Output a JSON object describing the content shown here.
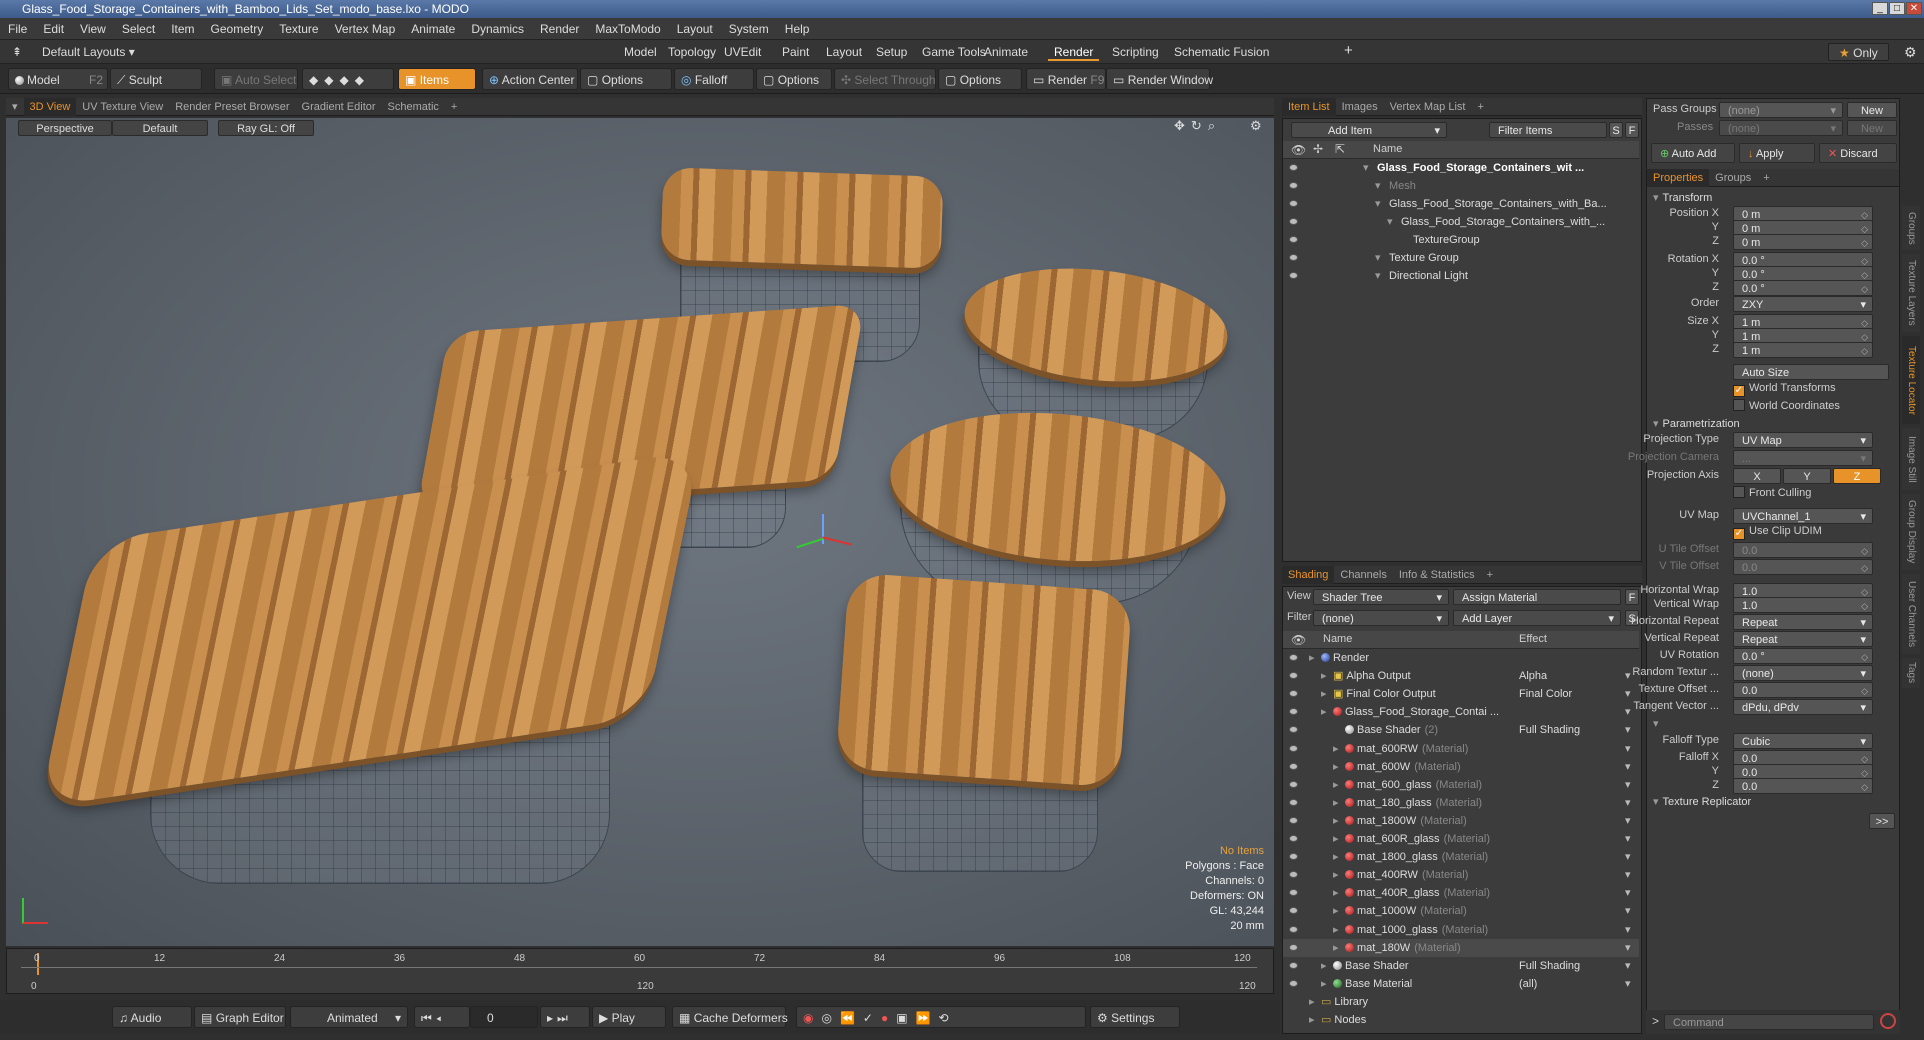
{
  "window": {
    "title": "Glass_Food_Storage_Containers_with_Bamboo_Lids_Set_modo_base.lxo - MODO",
    "controls": [
      "_",
      "□",
      "✕"
    ]
  },
  "menu": [
    "File",
    "Edit",
    "View",
    "Select",
    "Item",
    "Geometry",
    "Texture",
    "Vertex Map",
    "Animate",
    "Dynamics",
    "Render",
    "MaxToModo",
    "Layout",
    "System",
    "Help"
  ],
  "layout": {
    "preset": "Default Layouts ▾",
    "tabs": [
      "Model",
      "Topology",
      "UVEdit",
      "Paint",
      "Layout",
      "Setup",
      "Game Tools",
      "Animate",
      "Render",
      "Scripting",
      "Schematic Fusion"
    ],
    "active_tab": "Render",
    "only_label": "Only"
  },
  "toolbar": {
    "model": "Model",
    "model_key": "F2",
    "sculpt": "Sculpt",
    "auto_select": "Auto Select",
    "items": "Items",
    "action_center": "Action Center",
    "options1": "Options",
    "falloff": "Falloff",
    "options2": "Options",
    "select_through": "Select Through",
    "options3": "Options",
    "render": "Render",
    "render_key": "F9",
    "render_window": "Render Window"
  },
  "viewport": {
    "tabs": [
      "3D View",
      "UV Texture View",
      "Render Preset Browser",
      "Gradient Editor",
      "Schematic"
    ],
    "active_tab": "3D View",
    "perspective": "Perspective",
    "default": "Default",
    "raygl": "Ray GL: Off",
    "hud": {
      "status": "No Items",
      "polygons": "Polygons : Face",
      "channels": "Channels: 0",
      "deformers": "Deformers: ON",
      "gl": "GL: 43,244",
      "scale": "20 mm"
    }
  },
  "timeline": {
    "top_ticks": [
      "0",
      "12",
      "24",
      "36",
      "48",
      "60",
      "72",
      "84",
      "96",
      "108",
      "120"
    ],
    "bottom_start": "0",
    "bottom_mid": "120",
    "bottom_end": "120"
  },
  "bottom": {
    "audio": "Audio",
    "graph_editor": "Graph Editor",
    "animated": "Animated",
    "frame": "0",
    "play": "Play",
    "cache": "Cache Deformers",
    "settings": "Settings"
  },
  "item_list": {
    "tabs": [
      "Item List",
      "Images",
      "Vertex Map List"
    ],
    "active_tab": "Item List",
    "add_item": "Add Item",
    "filter": "Filter Items",
    "s": "S",
    "f": "F",
    "col_name": "Name",
    "rows": [
      {
        "label": "Glass_Food_Storage_Containers_wit ...",
        "indent": 0,
        "bold": true
      },
      {
        "label": "Mesh",
        "indent": 1,
        "dim": true
      },
      {
        "label": "Glass_Food_Storage_Containers_with_Ba...",
        "indent": 1
      },
      {
        "label": "Glass_Food_Storage_Containers_with_...",
        "indent": 2
      },
      {
        "label": "TextureGroup",
        "indent": 3
      },
      {
        "label": "Texture Group",
        "indent": 1
      },
      {
        "label": "Directional Light",
        "indent": 1
      }
    ]
  },
  "shading": {
    "tabs": [
      "Shading",
      "Channels",
      "Info & Statistics"
    ],
    "active_tab": "Shading",
    "view_label": "View",
    "view_value": "Shader Tree",
    "assign": "Assign Material",
    "filter_label": "Filter",
    "filter_value": "(none)",
    "add_layer": "Add Layer",
    "col_name": "Name",
    "col_effect": "Effect",
    "rows": [
      {
        "name": "Render",
        "suffix": "",
        "effect": "",
        "ball": "bl",
        "indent": 0
      },
      {
        "name": "Alpha Output",
        "suffix": "",
        "effect": "Alpha",
        "ball": "out",
        "indent": 1
      },
      {
        "name": "Final Color Output",
        "suffix": "",
        "effect": "Final Color",
        "ball": "out",
        "indent": 1
      },
      {
        "name": "Glass_Food_Storage_Contai ...",
        "suffix": "",
        "effect": "",
        "ball": "rd",
        "indent": 1
      },
      {
        "name": "Base Shader",
        "suffix": "(2)",
        "effect": "Full Shading",
        "ball": "wh",
        "indent": 2
      },
      {
        "name": "mat_600RW",
        "suffix": "(Material)",
        "effect": "",
        "ball": "rd",
        "indent": 2
      },
      {
        "name": "mat_600W",
        "suffix": "(Material)",
        "effect": "",
        "ball": "rd",
        "indent": 2
      },
      {
        "name": "mat_600_glass",
        "suffix": "(Material)",
        "effect": "",
        "ball": "rd",
        "indent": 2
      },
      {
        "name": "mat_180_glass",
        "suffix": "(Material)",
        "effect": "",
        "ball": "rd",
        "indent": 2
      },
      {
        "name": "mat_1800W",
        "suffix": "(Material)",
        "effect": "",
        "ball": "rd",
        "indent": 2
      },
      {
        "name": "mat_600R_glass",
        "suffix": "(Material)",
        "effect": "",
        "ball": "rd",
        "indent": 2
      },
      {
        "name": "mat_1800_glass",
        "suffix": "(Material)",
        "effect": "",
        "ball": "rd",
        "indent": 2
      },
      {
        "name": "mat_400RW",
        "suffix": "(Material)",
        "effect": "",
        "ball": "rd",
        "indent": 2
      },
      {
        "name": "mat_400R_glass",
        "suffix": "(Material)",
        "effect": "",
        "ball": "rd",
        "indent": 2
      },
      {
        "name": "mat_1000W",
        "suffix": "(Material)",
        "effect": "",
        "ball": "rd",
        "indent": 2
      },
      {
        "name": "mat_1000_glass",
        "suffix": "(Material)",
        "effect": "",
        "ball": "rd",
        "indent": 2
      },
      {
        "name": "mat_180W",
        "suffix": "(Material)",
        "effect": "",
        "ball": "rd",
        "indent": 2
      },
      {
        "name": "Base Shader",
        "suffix": "",
        "effect": "Full Shading",
        "ball": "wh",
        "indent": 1
      },
      {
        "name": "Base Material",
        "suffix": "",
        "effect": "(all)",
        "ball": "gr",
        "indent": 1
      },
      {
        "name": "Library",
        "suffix": "",
        "effect": "",
        "ball": "none",
        "indent": 0
      },
      {
        "name": "Nodes",
        "suffix": "",
        "effect": "",
        "ball": "none",
        "indent": 0
      }
    ]
  },
  "props": {
    "pass_groups": "Pass Groups",
    "pass_value": "(none)",
    "new": "New",
    "passes": "Passes",
    "passes_value": "(none)",
    "auto_add": "Auto Add",
    "apply": "Apply",
    "discard": "Discard",
    "tabs": [
      "Properties",
      "Groups"
    ],
    "active_tab": "Properties",
    "transform": "Transform",
    "position_x": "Position X",
    "pos": [
      "0 m",
      "0 m",
      "0 m"
    ],
    "rotation_x": "Rotation X",
    "rot": [
      "0.0 °",
      "0.0 °",
      "0.0 °"
    ],
    "order": "Order",
    "order_value": "ZXY",
    "size_x": "Size X",
    "size": [
      "1 m",
      "1 m",
      "1 m"
    ],
    "y": "Y",
    "z": "Z",
    "auto_size": "Auto Size",
    "world_transforms": "World Transforms",
    "world_coordinates": "World Coordinates",
    "parametrization": "Parametrization",
    "projection_type": "Projection Type",
    "projection_type_value": "UV Map",
    "projection_camera": "Projection Camera",
    "projection_camera_value": "...",
    "projection_axis": "Projection Axis",
    "axis": [
      "X",
      "Y",
      "Z"
    ],
    "front_culling": "Front Culling",
    "uv_map": "UV Map",
    "uv_map_value": "UVChannel_1",
    "use_clip_udim": "Use Clip UDIM",
    "u_tile": "U Tile Offset",
    "u_tile_value": "0.0",
    "v_tile": "V Tile Offset",
    "v_tile_value": "0.0",
    "h_wrap": "Horizontal Wrap",
    "h_wrap_value": "1.0",
    "v_wrap": "Vertical Wrap",
    "v_wrap_value": "1.0",
    "h_repeat": "Horizontal Repeat",
    "h_repeat_value": "Repeat",
    "v_repeat": "Vertical Repeat",
    "v_repeat_value": "Repeat",
    "uv_rotation": "UV Rotation",
    "uv_rotation_value": "0.0 °",
    "random": "Random Textur ...",
    "random_value": "(none)",
    "tex_offset": "Texture Offset ...",
    "tex_offset_value": "0.0",
    "tangent": "Tangent Vector ...",
    "tangent_value": "dPdu, dPdv",
    "falloff": [
      "0.0",
      "0.0",
      "0.0"
    ],
    "falloff_type": "Falloff Type",
    "falloff_type_value": "Cubic",
    "falloff_x": "Falloff X",
    "texture_replicator": "Texture Replicator",
    "more": ">>",
    "command": "Command"
  },
  "side_tabs": [
    "Groups",
    "Texture Layers",
    "Texture Locator",
    "Image Still",
    "Group Display",
    "User Channels",
    "Tags"
  ]
}
